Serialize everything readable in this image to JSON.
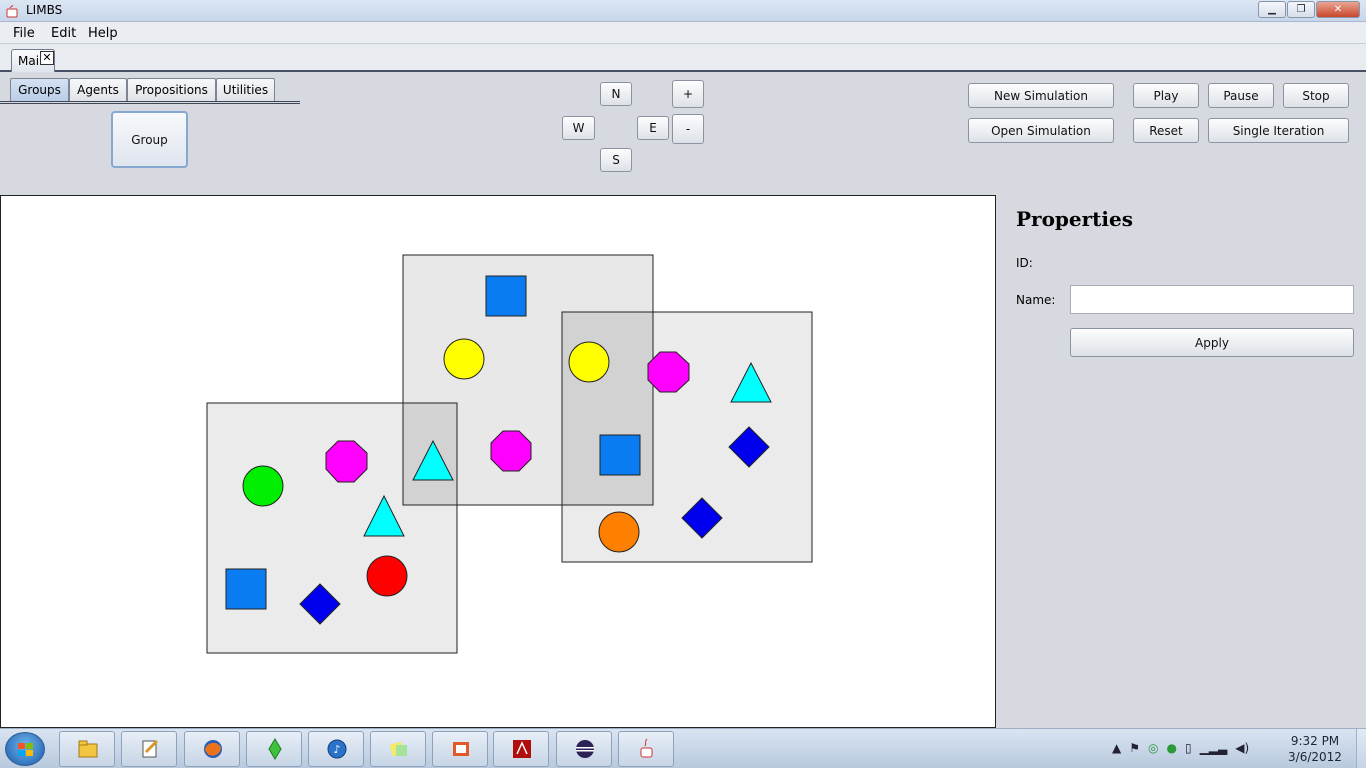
{
  "window": {
    "title": "LIMBS"
  },
  "menubar": {
    "items": [
      "File",
      "Edit",
      "Help"
    ]
  },
  "doc_tab": {
    "label": "Main"
  },
  "palette_tabs": [
    "Groups",
    "Agents",
    "Propositions",
    "Utilities"
  ],
  "palette": {
    "group_button": "Group"
  },
  "navigation": {
    "north": "N",
    "south": "S",
    "east": "E",
    "west": "W",
    "zoom_in": "+",
    "zoom_out": "-"
  },
  "simulation": {
    "new": "New Simulation",
    "open": "Open Simulation",
    "play": "Play",
    "pause": "Pause",
    "stop": "Stop",
    "reset": "Reset",
    "single_iteration": "Single Iteration"
  },
  "properties": {
    "title": "Properties",
    "id_label": "ID:",
    "name_label": "Name:",
    "name_value": "",
    "apply_label": "Apply"
  },
  "canvas": {
    "groups": 3,
    "agents": [
      {
        "shape": "square",
        "color": "#0a7cf2"
      },
      {
        "shape": "circle",
        "color": "#ffff00"
      },
      {
        "shape": "circle",
        "color": "#ffff00"
      },
      {
        "shape": "octagon",
        "color": "#ff00ff"
      },
      {
        "shape": "triangle",
        "color": "#00ffff"
      },
      {
        "shape": "octagon",
        "color": "#ff00ff"
      },
      {
        "shape": "square",
        "color": "#0a7cf2"
      },
      {
        "shape": "diamond",
        "color": "#0000ee"
      },
      {
        "shape": "triangle",
        "color": "#00ffff"
      },
      {
        "shape": "diamond",
        "color": "#0000ee"
      },
      {
        "shape": "circle",
        "color": "#ff7f00"
      },
      {
        "shape": "circle",
        "color": "#00ee00"
      },
      {
        "shape": "octagon",
        "color": "#ff00ff"
      },
      {
        "shape": "triangle",
        "color": "#00ffff"
      },
      {
        "shape": "circle",
        "color": "#ff0000"
      },
      {
        "shape": "square",
        "color": "#0a7cf2"
      },
      {
        "shape": "diamond",
        "color": "#0000ee"
      }
    ]
  },
  "taskbar": {
    "apps": [
      "file-explorer-icon",
      "notepad-icon",
      "firefox-icon",
      "sims-icon",
      "itunes-icon",
      "sticky-notes-icon",
      "powerpoint-icon",
      "acrobat-icon",
      "eclipse-icon",
      "java-icon"
    ],
    "clock_time": "9:32 PM",
    "clock_date": "3/6/2012"
  }
}
